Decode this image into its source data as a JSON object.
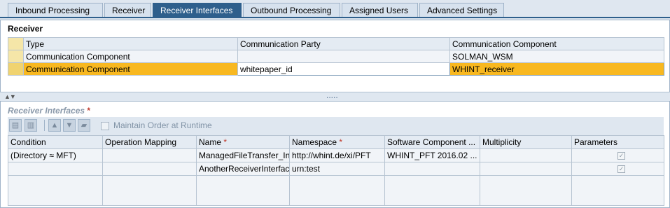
{
  "tabs": [
    {
      "label": "Inbound Processing",
      "active": false
    },
    {
      "label": "Receiver",
      "active": false
    },
    {
      "label": "Receiver Interfaces",
      "active": true
    },
    {
      "label": "Outbound Processing",
      "active": false
    },
    {
      "label": "Assigned Users",
      "active": false
    },
    {
      "label": "Advanced Settings",
      "active": false
    }
  ],
  "receiver": {
    "title": "Receiver",
    "columns": [
      "Type",
      "Communication Party",
      "Communication Component"
    ],
    "rows": [
      {
        "type": "Communication Component",
        "party": "",
        "component": "SOLMAN_WSM",
        "selected": false
      },
      {
        "type": "Communication Component",
        "party": "whitepaper_id",
        "component": "WHINT_receiver",
        "selected": true
      }
    ]
  },
  "splitter": {
    "grip": "....."
  },
  "receiver_interfaces": {
    "title": "Receiver Interfaces",
    "required_mark": "*",
    "toolbar": {
      "maintain_order_label": "Maintain Order at Runtime",
      "maintain_order_checked": false
    },
    "columns": [
      {
        "label": "Condition",
        "required": false
      },
      {
        "label": "Operation Mapping",
        "required": false
      },
      {
        "label": "Name",
        "required": true
      },
      {
        "label": "Namespace",
        "required": true
      },
      {
        "label": "Software Component ...",
        "required": false
      },
      {
        "label": "Multiplicity",
        "required": false
      },
      {
        "label": "Parameters",
        "required": false
      }
    ],
    "rows": [
      {
        "condition": "(Directory ≈ MFT)",
        "operation_mapping": "",
        "name": "ManagedFileTransfer_Inb",
        "namespace": "http://whint.de/xi/PFT",
        "software_component": "WHINT_PFT 2016.02 ...",
        "multiplicity": "",
        "parameters_checked": true
      },
      {
        "condition": "",
        "operation_mapping": "",
        "name": "AnotherReceiverInterface",
        "namespace": "urn:test",
        "software_component": "",
        "multiplicity": "",
        "parameters_checked": true
      }
    ]
  },
  "colors": {
    "active_tab": "#2e5f8c",
    "selected_row": "#f8b820",
    "required": "#c0392b"
  }
}
